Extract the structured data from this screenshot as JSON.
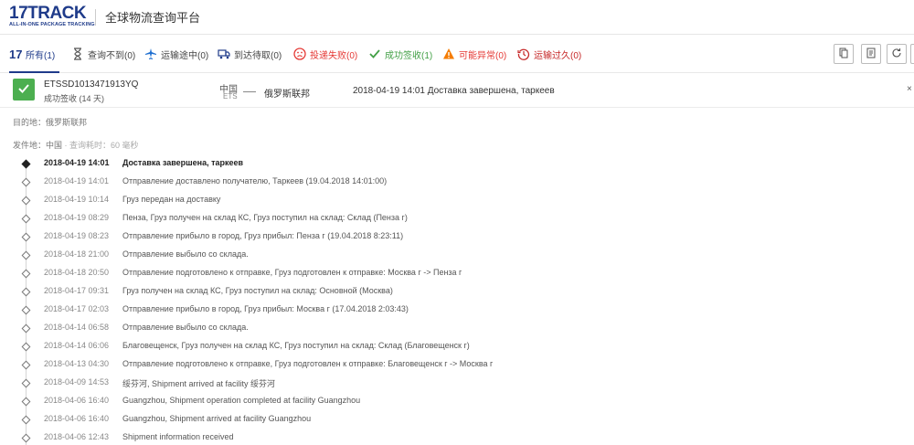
{
  "header": {
    "logo_text": "17TRACK",
    "logo_tagline": "ALL-IN-ONE PACKAGE TRACKING",
    "platform_title": "全球物流查询平台"
  },
  "tabs": [
    {
      "label": "所有(1)",
      "icon": "17-logo-icon",
      "active": true
    },
    {
      "label": "查询不到(0)",
      "icon": "hourglass-icon"
    },
    {
      "label": "运输途中(0)",
      "icon": "airplane-icon"
    },
    {
      "label": "到达待取(0)",
      "icon": "truck-icon"
    },
    {
      "label": "投递失败(0)",
      "icon": "sad-face-icon",
      "color": "#e53935"
    },
    {
      "label": "成功签收(1)",
      "icon": "check-icon",
      "color": "#43a047"
    },
    {
      "label": "可能异常(0)",
      "icon": "warning-icon",
      "color": "#e53935"
    },
    {
      "label": "运输过久(0)",
      "icon": "clock-history-icon",
      "color": "#c62828"
    }
  ],
  "colors": {
    "brand": "#1f3b8a",
    "success": "#4caf50",
    "danger": "#e53935",
    "warning": "#f57c00"
  },
  "package": {
    "tracking_number": "ETSSD1013471913YQ",
    "status_text": "成功签收 (14 天)",
    "origin_country": "中国",
    "origin_carrier": "ETS",
    "destination_country": "俄罗斯联邦",
    "latest_event": "2018-04-19 14:01  Доставка завершена, таркеев",
    "close_symbol": "×"
  },
  "details": {
    "destination_label": "目的地：俄罗斯联邦",
    "origin_label": "发件地：中国",
    "query_time": "· 查询耗时：60 毫秒"
  },
  "events": [
    {
      "date": "2018-04-19 14:01",
      "text": "Доставка завершена, таркеев"
    },
    {
      "date": "2018-04-19 14:01",
      "text": "Отправление доставлено получателю, Таркеев (19.04.2018 14:01:00)"
    },
    {
      "date": "2018-04-19 10:14",
      "text": "Груз передан на доставку"
    },
    {
      "date": "2018-04-19 08:29",
      "text": "Пенза, Груз получен на склад КС, Груз поступил на склад: Склад (Пенза г)"
    },
    {
      "date": "2018-04-19 08:23",
      "text": "Отправление прибыло в город, Груз прибыл: Пенза г (19.04.2018 8:23:11)"
    },
    {
      "date": "2018-04-18 21:00",
      "text": "Отправление выбыло со склада."
    },
    {
      "date": "2018-04-18 20:50",
      "text": "Отправление подготовлено к отправке, Груз подготовлен к отправке: Москва г -> Пенза г"
    },
    {
      "date": "2018-04-17 09:31",
      "text": "Груз получен на склад КС, Груз поступил на склад: Основной (Москва)"
    },
    {
      "date": "2018-04-17 02:03",
      "text": "Отправление прибыло в город, Груз прибыл: Москва г (17.04.2018 2:03:43)"
    },
    {
      "date": "2018-04-14 06:58",
      "text": "Отправление выбыло со склада."
    },
    {
      "date": "2018-04-14 06:06",
      "text": "Благовещенск, Груз получен на склад КС, Груз поступил на склад: Склад (Благовещенск г)"
    },
    {
      "date": "2018-04-13 04:30",
      "text": "Отправление подготовлено к отправке, Груз подготовлен к отправке: Благовещенск г -> Москва г"
    },
    {
      "date": "2018-04-09 14:53",
      "text": "绥芬河, Shipment arrived at facility 绥芬河"
    },
    {
      "date": "2018-04-06 16:40",
      "text": "Guangzhou, Shipment operation completed at facility Guangzhou"
    },
    {
      "date": "2018-04-06 16:40",
      "text": "Guangzhou, Shipment arrived at facility Guangzhou"
    },
    {
      "date": "2018-04-06 12:43",
      "text": "Shipment information received"
    }
  ]
}
